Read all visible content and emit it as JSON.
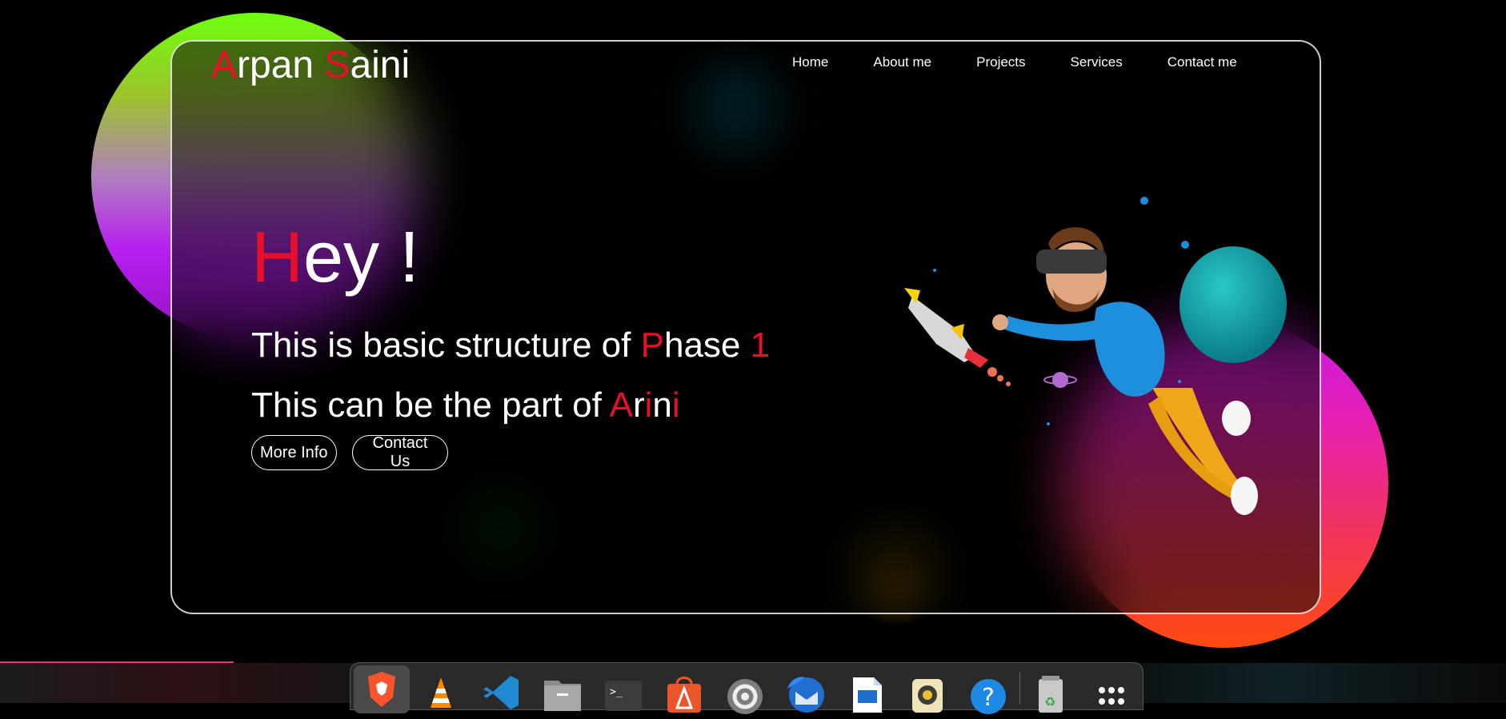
{
  "logo": {
    "first_initial": "A",
    "first_rest": "rpan ",
    "last_initial": "S",
    "last_rest": "aini"
  },
  "nav": {
    "items": [
      "Home",
      "About me",
      "Projects",
      "Services",
      "Contact me"
    ]
  },
  "hero": {
    "hey_initial": "H",
    "hey_rest": "ey !",
    "line1_text": "This is basic structure of ",
    "line1_p": "P",
    "line1_hase": "hase ",
    "line1_num": "1",
    "line2_text": "This can be the part of ",
    "line2_a": "A",
    "line2_r": "r",
    "line2_i1": "i",
    "line2_n": "n",
    "line2_i2": "i"
  },
  "buttons": {
    "more_info": "More Info",
    "contact_us": "Contact Us"
  },
  "colors": {
    "accent": "#e80f2a",
    "background": "#000000",
    "text": "#ffffff"
  },
  "dock": {
    "apps": [
      "brave-icon",
      "vlc-icon",
      "vscode-icon",
      "files-icon",
      "terminal-icon",
      "app-center-icon",
      "settings-icon",
      "thunderbird-icon",
      "libreoffice-impress-icon",
      "rhythmbox-icon",
      "help-icon",
      "trash-icon",
      "show-apps-icon"
    ],
    "terminal_glyph": ">_",
    "help_glyph": "?",
    "trash_glyph": "♻"
  }
}
